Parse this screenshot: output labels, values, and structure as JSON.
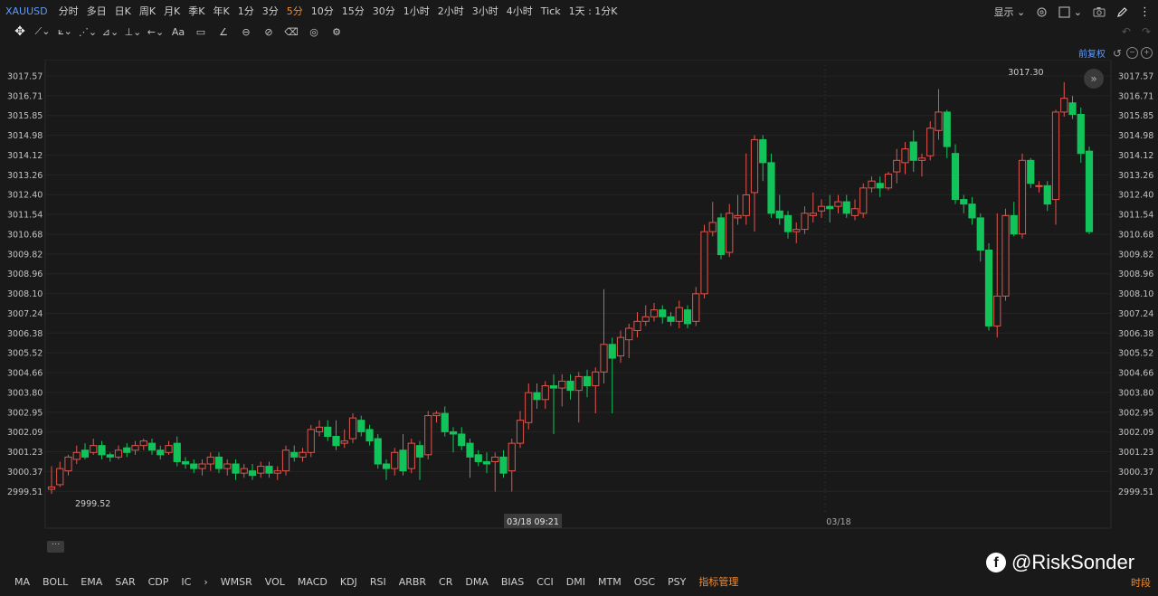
{
  "topbar": {
    "symbol": "XAUUSD",
    "intervals": [
      "分时",
      "多日",
      "日K",
      "周K",
      "月K",
      "季K",
      "年K",
      "1分",
      "3分",
      "5分",
      "10分",
      "15分",
      "30分",
      "1小时",
      "2小时",
      "3小时",
      "4小时",
      "Tick",
      "1天 : 1分K"
    ],
    "active_interval": "5分",
    "display_label": "显示"
  },
  "sub_toolbar": {
    "adjust_label": "前复权"
  },
  "colors": {
    "up": "#e3544c",
    "down": "#12c35a",
    "background": "#191919",
    "grid": "#242424"
  },
  "chart_data": {
    "type": "candlestick",
    "y_ticks": [
      "3017.57",
      "3016.71",
      "3015.85",
      "3014.98",
      "3014.12",
      "3013.26",
      "3012.40",
      "3011.54",
      "3010.68",
      "3009.82",
      "3008.96",
      "3008.10",
      "3007.24",
      "3006.38",
      "3005.52",
      "3004.66",
      "3003.80",
      "3002.95",
      "3002.09",
      "3001.23",
      "3000.37",
      "2999.51"
    ],
    "ylim": [
      2999.51,
      3017.57
    ],
    "max_label": "3017.30",
    "min_label": "2999.52",
    "crosshair_time": "03/18 09:21",
    "x_label": "03/18",
    "candles": [
      [
        2999.6,
        2999.7,
        2999.4,
        3000.6
      ],
      [
        2999.8,
        3000.5,
        2999.7,
        3000.8
      ],
      [
        3000.4,
        3001.0,
        3000.2,
        3001.1
      ],
      [
        3000.9,
        3001.2,
        3000.7,
        3001.5
      ],
      [
        3001.3,
        3001.0,
        3000.9,
        3001.6
      ],
      [
        3001.2,
        3001.5,
        3001.1,
        3001.8
      ],
      [
        3001.5,
        3001.1,
        3000.9,
        3001.7
      ],
      [
        3001.1,
        3001.0,
        3000.8,
        3001.2
      ],
      [
        3001.0,
        3001.3,
        3000.9,
        3001.5
      ],
      [
        3001.4,
        3001.2,
        3001.0,
        3001.6
      ],
      [
        3001.3,
        3001.5,
        3001.1,
        3001.7
      ],
      [
        3001.5,
        3001.7,
        3001.3,
        3001.8
      ],
      [
        3001.6,
        3001.3,
        3001.1,
        3001.8
      ],
      [
        3001.3,
        3001.1,
        3000.9,
        3001.5
      ],
      [
        3001.2,
        3001.5,
        3001.1,
        3001.7
      ],
      [
        3001.6,
        3000.8,
        3000.6,
        3001.9
      ],
      [
        3000.8,
        3000.7,
        3000.5,
        3001.0
      ],
      [
        3000.7,
        3000.5,
        3000.3,
        3000.9
      ],
      [
        3000.5,
        3000.7,
        3000.2,
        3000.9
      ],
      [
        3000.7,
        3001.0,
        3000.4,
        3001.2
      ],
      [
        3001.0,
        3000.5,
        3000.3,
        3001.2
      ],
      [
        3000.5,
        3000.7,
        3000.2,
        3000.9
      ],
      [
        3000.7,
        3000.3,
        3000.0,
        3000.9
      ],
      [
        3000.3,
        3000.5,
        3000.1,
        3000.7
      ],
      [
        3000.4,
        3000.2,
        3000.0,
        3000.7
      ],
      [
        3000.3,
        3000.6,
        3000.1,
        3000.8
      ],
      [
        3000.6,
        3000.3,
        3000.1,
        3000.8
      ],
      [
        3000.3,
        3000.4,
        3000.0,
        3000.6
      ],
      [
        3000.4,
        3001.3,
        3000.2,
        3001.5
      ],
      [
        3001.2,
        3001.0,
        3000.8,
        3001.5
      ],
      [
        3001.0,
        3001.2,
        3000.8,
        3001.4
      ],
      [
        3001.2,
        3002.2,
        3001.0,
        3002.4
      ],
      [
        3002.1,
        3002.3,
        3001.9,
        3002.6
      ],
      [
        3002.3,
        3001.9,
        3001.7,
        3002.6
      ],
      [
        3001.9,
        3001.5,
        3001.3,
        3002.6
      ],
      [
        3001.6,
        3001.7,
        3001.4,
        3002.2
      ],
      [
        3001.8,
        3002.7,
        3001.6,
        3002.9
      ],
      [
        3002.6,
        3002.1,
        3001.9,
        3002.8
      ],
      [
        3002.2,
        3001.7,
        3001.5,
        3002.4
      ],
      [
        3001.8,
        3000.7,
        3000.5,
        3002.0
      ],
      [
        3000.7,
        3000.5,
        3000.0,
        3000.9
      ],
      [
        3000.5,
        3001.2,
        3000.2,
        3001.4
      ],
      [
        3001.3,
        3000.4,
        3000.2,
        3002.0
      ],
      [
        3000.5,
        3001.6,
        3000.3,
        3001.8
      ],
      [
        3001.5,
        3001.0,
        3000.0,
        3001.7
      ],
      [
        3001.1,
        3002.8,
        3000.9,
        3003.0
      ],
      [
        3002.8,
        3002.9,
        3002.5,
        3003.0
      ],
      [
        3002.9,
        3002.1,
        3001.9,
        3003.2
      ],
      [
        3002.1,
        3002.0,
        3001.2,
        3002.3
      ],
      [
        3002.0,
        3001.5,
        3001.3,
        3002.3
      ],
      [
        3001.6,
        3001.0,
        3000.1,
        3001.8
      ],
      [
        3001.1,
        3000.8,
        3000.6,
        3001.3
      ],
      [
        3000.8,
        3000.7,
        3000.3,
        3001.2
      ],
      [
        3000.8,
        3001.0,
        2999.5,
        3001.2
      ],
      [
        3001.0,
        3000.3,
        3000.1,
        3001.3
      ],
      [
        3000.4,
        3001.6,
        2999.5,
        3001.8
      ],
      [
        3001.6,
        3002.6,
        3001.4,
        3003.0
      ],
      [
        3002.5,
        3003.8,
        3002.2,
        3004.2
      ],
      [
        3003.8,
        3003.5,
        3003.1,
        3004.2
      ],
      [
        3003.5,
        3004.1,
        3003.1,
        3004.3
      ],
      [
        3004.1,
        3004.0,
        3002.0,
        3004.6
      ],
      [
        3004.0,
        3004.3,
        3003.2,
        3004.6
      ],
      [
        3004.3,
        3003.9,
        3003.5,
        3004.6
      ],
      [
        3003.9,
        3004.5,
        3002.5,
        3004.7
      ],
      [
        3004.5,
        3004.1,
        3003.6,
        3004.8
      ],
      [
        3004.1,
        3004.7,
        3002.9,
        3004.9
      ],
      [
        3004.7,
        3005.9,
        3004.2,
        3008.3
      ],
      [
        3005.9,
        3005.3,
        3002.9,
        3006.2
      ],
      [
        3005.4,
        3006.2,
        3005.1,
        3006.5
      ],
      [
        3006.1,
        3006.6,
        3005.3,
        3006.8
      ],
      [
        3006.5,
        3006.9,
        3006.2,
        3007.3
      ],
      [
        3006.9,
        3007.1,
        3006.7,
        3007.6
      ],
      [
        3007.1,
        3007.4,
        3006.9,
        3007.7
      ],
      [
        3007.4,
        3007.1,
        3006.8,
        3007.6
      ],
      [
        3007.1,
        3006.9,
        3006.7,
        3007.3
      ],
      [
        3006.9,
        3007.5,
        3006.6,
        3007.8
      ],
      [
        3007.4,
        3006.8,
        3006.6,
        3007.6
      ],
      [
        3006.9,
        3008.1,
        3006.7,
        3008.4
      ],
      [
        3008.1,
        3010.8,
        3007.9,
        3011.1
      ],
      [
        3010.8,
        3011.2,
        3010.6,
        3012.1
      ],
      [
        3011.4,
        3009.8,
        3009.6,
        3011.6
      ],
      [
        3009.9,
        3011.6,
        3009.7,
        3012.0
      ],
      [
        3011.4,
        3011.5,
        3011.1,
        3012.4
      ],
      [
        3011.5,
        3012.4,
        3011.1,
        3014.2
      ],
      [
        3012.5,
        3014.8,
        3010.8,
        3015.0
      ],
      [
        3014.8,
        3013.8,
        3013.0,
        3015.0
      ],
      [
        3013.8,
        3011.6,
        3011.4,
        3014.2
      ],
      [
        3011.7,
        3011.4,
        3011.1,
        3012.4
      ],
      [
        3011.5,
        3010.8,
        3010.5,
        3011.7
      ],
      [
        3010.8,
        3010.9,
        3010.3,
        3011.2
      ],
      [
        3010.9,
        3011.6,
        3010.7,
        3011.9
      ],
      [
        3011.5,
        3011.6,
        3011.2,
        3012.5
      ],
      [
        3011.7,
        3011.9,
        3011.4,
        3012.2
      ],
      [
        3011.9,
        3011.8,
        3011.2,
        3012.4
      ],
      [
        3011.9,
        3012.1,
        3011.6,
        3012.4
      ],
      [
        3012.1,
        3011.6,
        3011.4,
        3012.4
      ],
      [
        3011.5,
        3011.8,
        3011.3,
        3012.2
      ],
      [
        3011.6,
        3012.7,
        3011.4,
        3012.9
      ],
      [
        3012.7,
        3013.0,
        3012.5,
        3013.2
      ],
      [
        3012.9,
        3012.7,
        3012.3,
        3013.2
      ],
      [
        3012.7,
        3013.3,
        3012.6,
        3013.4
      ],
      [
        3013.4,
        3013.9,
        3012.9,
        3014.4
      ],
      [
        3013.8,
        3014.4,
        3013.3,
        3014.7
      ],
      [
        3014.7,
        3013.9,
        3013.4,
        3015.2
      ],
      [
        3013.9,
        3014.0,
        3013.2,
        3014.2
      ],
      [
        3014.1,
        3015.3,
        3013.9,
        3015.6
      ],
      [
        3015.2,
        3016.0,
        3014.8,
        3017.0
      ],
      [
        3016.0,
        3014.5,
        3014.0,
        3016.1
      ],
      [
        3014.2,
        3012.2,
        3012.0,
        3014.6
      ],
      [
        3012.2,
        3012.0,
        3011.6,
        3012.4
      ],
      [
        3012.0,
        3011.4,
        3011.1,
        3012.3
      ],
      [
        3011.4,
        3010.0,
        3009.5,
        3011.6
      ],
      [
        3010.0,
        3006.7,
        3006.5,
        3010.3
      ],
      [
        3006.7,
        3008.0,
        3006.2,
        3011.6
      ],
      [
        3008.0,
        3011.5,
        3007.8,
        3011.8
      ],
      [
        3011.5,
        3010.7,
        3010.6,
        3012.1
      ],
      [
        3010.7,
        3013.9,
        3010.5,
        3014.2
      ],
      [
        3013.9,
        3012.9,
        3012.7,
        3014.0
      ],
      [
        3012.8,
        3012.8,
        3012.5,
        3013.0
      ],
      [
        3012.8,
        3012.0,
        3011.7,
        3013.0
      ],
      [
        3012.2,
        3016.0,
        3011.1,
        3016.1
      ],
      [
        3016.0,
        3016.6,
        3015.8,
        3017.3
      ],
      [
        3016.4,
        3015.9,
        3015.7,
        3016.7
      ],
      [
        3015.9,
        3014.2,
        3013.8,
        3016.2
      ],
      [
        3014.3,
        3010.8,
        3010.7,
        3014.5
      ]
    ]
  },
  "indicators": [
    "MA",
    "BOLL",
    "EMA",
    "SAR",
    "CDP",
    "IC",
    "›",
    "WMSR",
    "VOL",
    "MACD",
    "KDJ",
    "RSI",
    "ARBR",
    "CR",
    "DMA",
    "BIAS",
    "CCI",
    "DMI",
    "MTM",
    "OSC",
    "PSY",
    "指标管理"
  ],
  "time_seg_label": "时段",
  "watermark": "@RiskSonder"
}
